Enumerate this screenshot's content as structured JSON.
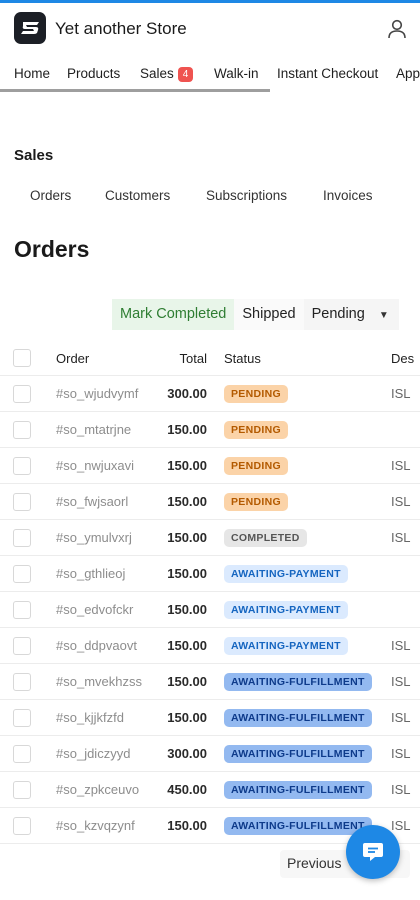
{
  "app": {
    "title": "Yet another Store"
  },
  "nav": {
    "items": [
      {
        "label": "Home"
      },
      {
        "label": "Products"
      },
      {
        "label": "Sales",
        "badge": "4"
      },
      {
        "label": "Walk-in"
      },
      {
        "label": "Instant Checkout"
      },
      {
        "label": "App"
      }
    ]
  },
  "section": {
    "title": "Sales"
  },
  "subtabs": [
    {
      "label": "Orders"
    },
    {
      "label": "Customers"
    },
    {
      "label": "Subscriptions"
    },
    {
      "label": "Invoices"
    }
  ],
  "page": {
    "title": "Orders"
  },
  "actions": {
    "mark_completed": "Mark Completed",
    "shipped": "Shipped",
    "pending": "Pending"
  },
  "table": {
    "headers": {
      "order": "Order",
      "total": "Total",
      "status": "Status",
      "desc": "Des"
    },
    "rows": [
      {
        "order": "#so_wjudvymf",
        "total": "300.00",
        "status": "PENDING",
        "desc": "ISL"
      },
      {
        "order": "#so_mtatrjne",
        "total": "150.00",
        "status": "PENDING",
        "desc": ""
      },
      {
        "order": "#so_nwjuxavi",
        "total": "150.00",
        "status": "PENDING",
        "desc": "ISL"
      },
      {
        "order": "#so_fwjsaorl",
        "total": "150.00",
        "status": "PENDING",
        "desc": "ISL"
      },
      {
        "order": "#so_ymulvxrj",
        "total": "150.00",
        "status": "COMPLETED",
        "desc": "ISL"
      },
      {
        "order": "#so_gthlieoj",
        "total": "150.00",
        "status": "AWAITING-PAYMENT",
        "desc": ""
      },
      {
        "order": "#so_edvofckr",
        "total": "150.00",
        "status": "AWAITING-PAYMENT",
        "desc": ""
      },
      {
        "order": "#so_ddpvaovt",
        "total": "150.00",
        "status": "AWAITING-PAYMENT",
        "desc": "ISL"
      },
      {
        "order": "#so_mvekhzss",
        "total": "150.00",
        "status": "AWAITING-FULFILLMENT",
        "desc": "ISL"
      },
      {
        "order": "#so_kjjkfzfd",
        "total": "150.00",
        "status": "AWAITING-FULFILLMENT",
        "desc": "ISL"
      },
      {
        "order": "#so_jdiczyyd",
        "total": "300.00",
        "status": "AWAITING-FULFILLMENT",
        "desc": "ISL"
      },
      {
        "order": "#so_zpkceuvo",
        "total": "450.00",
        "status": "AWAITING-FULFILLMENT",
        "desc": "ISL"
      },
      {
        "order": "#so_kzvqzynf",
        "total": "150.00",
        "status": "AWAITING-FULFILLMENT",
        "desc": "ISL"
      }
    ]
  },
  "status_colors": {
    "PENDING": {
      "bg": "#fbd3a8",
      "fg": "#b35a00"
    },
    "COMPLETED": {
      "bg": "#e6e6e6",
      "fg": "#555555"
    },
    "AWAITING-PAYMENT": {
      "bg": "#dbeafe",
      "fg": "#1565c0"
    },
    "AWAITING-FULFILLMENT": {
      "bg": "#93b9f0",
      "fg": "#0d3a8a"
    }
  },
  "pagination": {
    "previous": "Previous"
  },
  "icons": {
    "logo": "store-logo-icon",
    "user": "user-icon",
    "chat": "chat-icon",
    "caret": "chevron-down-icon"
  }
}
